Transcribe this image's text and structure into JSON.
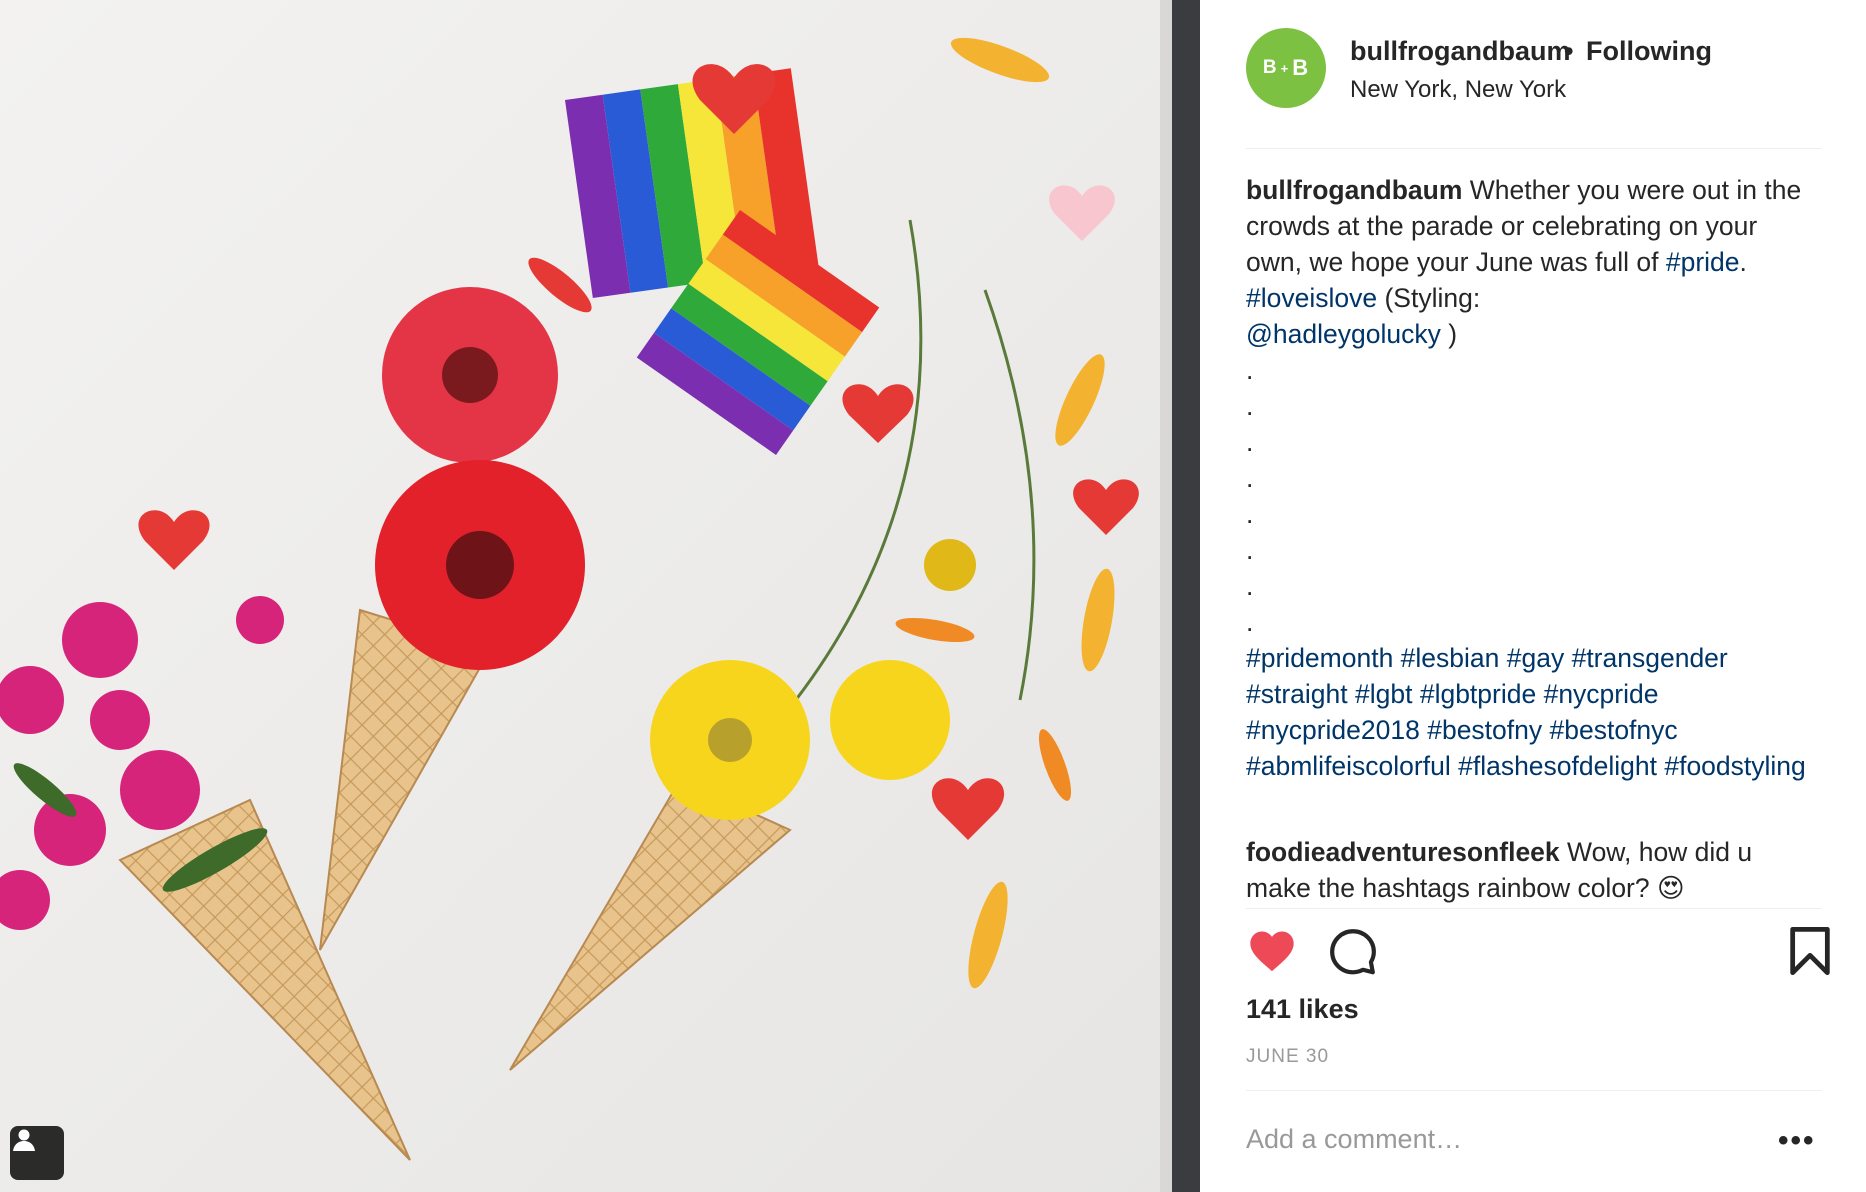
{
  "post": {
    "avatar_text": {
      "left": "B",
      "mid": "+",
      "right": "B"
    },
    "username": "bullfrogandbaum",
    "separator": "•",
    "follow_status": "Following",
    "location": "New York, New York",
    "caption": {
      "author": "bullfrogandbaum",
      "text_1": "Whether you were out in the crowds at the parade or celebrating on your own, we hope your June was full of",
      "tag_pride": "#pride",
      "text_2": ".",
      "tag_loveislove": "#loveislove",
      "text_3": "(Styling:",
      "mention": "@hadleygolucky",
      "text_4": ")",
      "dots": [
        ".",
        ".",
        ".",
        ".",
        ".",
        ".",
        ".",
        "."
      ],
      "hashtags": "#pridemonth #lesbian #gay #transgender #straight #lgbt #lgbtpride #nycpride #nycpride2018 #bestofny #bestofnyc #abmlifeiscolorful #flashesofdelight #foodstyling"
    },
    "comment": {
      "author": "foodieadventuresonfleek",
      "text": "Wow, how did u make the hashtags rainbow color?",
      "emoji": "😍"
    },
    "likes": "141 likes",
    "date": "JUNE 30",
    "add_comment_placeholder": "Add a comment…",
    "more_label": "•••"
  },
  "icons": {
    "like": "heart-icon",
    "comment": "comment-bubble-icon",
    "save": "bookmark-icon",
    "tag": "user-tag-icon",
    "more": "more-options-icon"
  },
  "colors": {
    "like_active": "#ed4956",
    "link": "#003569",
    "avatar_bg": "#7dc142",
    "muted": "#999999"
  }
}
